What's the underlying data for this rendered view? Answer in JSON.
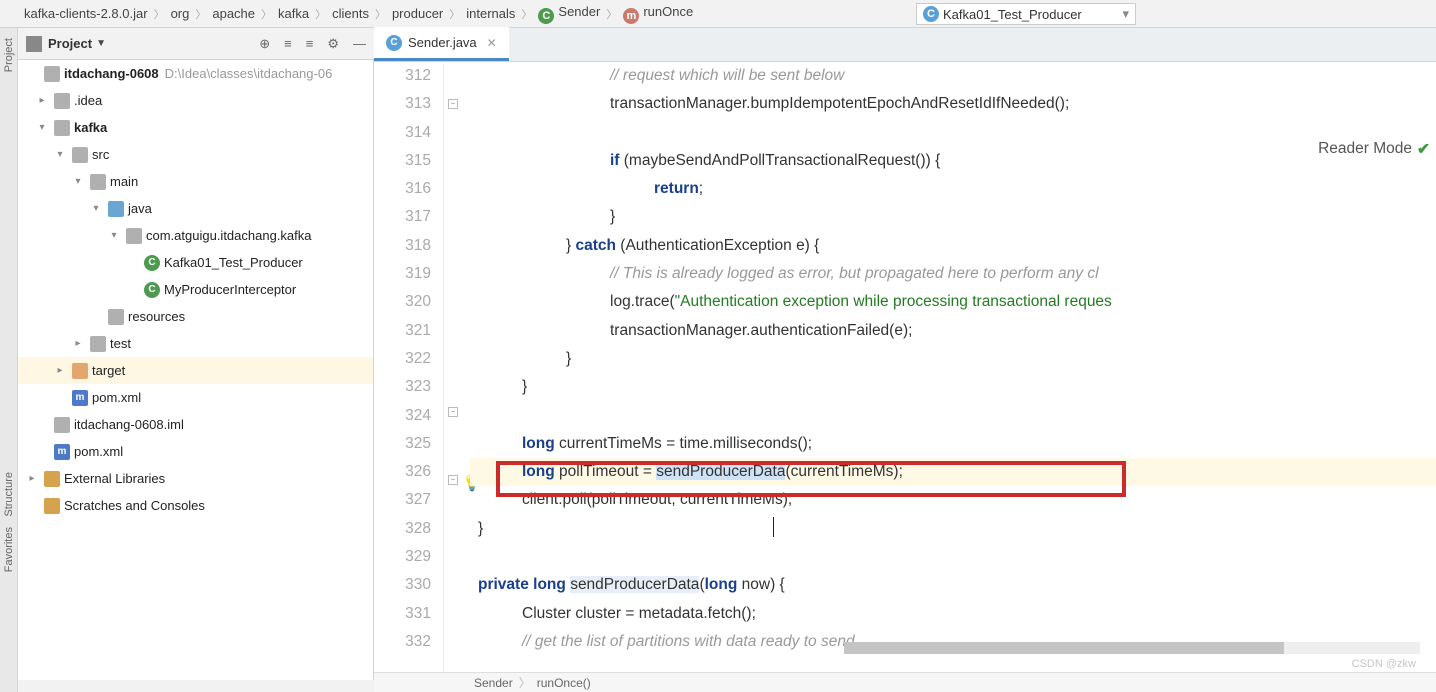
{
  "breadcrumbs": {
    "items": [
      "kafka-clients-2.8.0.jar",
      "org",
      "apache",
      "kafka",
      "clients",
      "producer",
      "internals"
    ],
    "class_item": "Sender",
    "method_item": "runOnce"
  },
  "run_config": {
    "label": "Kafka01_Test_Producer"
  },
  "left_tabs": {
    "project": "Project",
    "structure": "Structure",
    "favorites": "Favorites"
  },
  "project_panel": {
    "title": "Project"
  },
  "tree": {
    "root": {
      "name": "itdachang-0608",
      "path": "D:\\Idea\\classes\\itdachang-06"
    },
    "idea": ".idea",
    "kafka": "kafka",
    "src": "src",
    "main": "main",
    "java": "java",
    "pkg": "com.atguigu.itdachang.kafka",
    "file1": "Kafka01_Test_Producer",
    "file2": "MyProducerInterceptor",
    "resources": "resources",
    "test": "test",
    "target": "target",
    "pom1": "pom.xml",
    "iml": "itdachang-0608.iml",
    "pom2": "pom.xml",
    "ext_lib": "External Libraries",
    "scratches": "Scratches and Consoles"
  },
  "tab": {
    "file": "Sender.java"
  },
  "reader_mode": "Reader Mode",
  "gutter": {
    "start": 312,
    "end": 332,
    "bulb_line": 326
  },
  "code": {
    "l312": {
      "cm": "// request which will be sent below"
    },
    "l313": {
      "a": "transactionManager",
      "b": ".bumpIdempotentEpochAndResetIdIfNeeded();"
    },
    "l314": "",
    "l315": {
      "kw": "if",
      "txt": " (maybeSendAndPollTransactionalRequest()) {"
    },
    "l316": {
      "kw": "return",
      "txt": ";"
    },
    "l317": "}",
    "l318": {
      "a": "} ",
      "kw": "catch",
      "b": " (AuthenticationException e) {"
    },
    "l319": {
      "cm": "// This is already logged as error, but propagated here to perform any cl"
    },
    "l320": {
      "a": "log.trace(",
      "str": "\"Authentication exception while processing transactional reques",
      "b": ""
    },
    "l321": {
      "a": "transactionManager",
      "b": ".authenticationFailed(e);"
    },
    "l322": "}",
    "l323": "}",
    "l324": "",
    "l325": {
      "kw": "long",
      "a": " currentTimeMs = time.milliseconds();"
    },
    "l326": {
      "kw": "long",
      "a": " pollTimeout = ",
      "hl": "sendProducerData",
      "b": "(currentTimeMs);"
    },
    "l327": {
      "a": "client",
      "b": ".poll(pollTimeout, currentTimeMs);"
    },
    "l328": "}",
    "l329": "",
    "l330": {
      "kw1": "private",
      "kw2": "long",
      "hl": "sendProducerData",
      "a": "(",
      "kw3": "long",
      "b": " now) {"
    },
    "l331": {
      "a": "Cluster cluster = metadata",
      "b": ".fetch();"
    },
    "l332": {
      "cm": "// get the list of partitions with data ready to send"
    }
  },
  "bottom": {
    "a": "Sender",
    "b": "runOnce()"
  },
  "watermark": "CSDN @zkw"
}
